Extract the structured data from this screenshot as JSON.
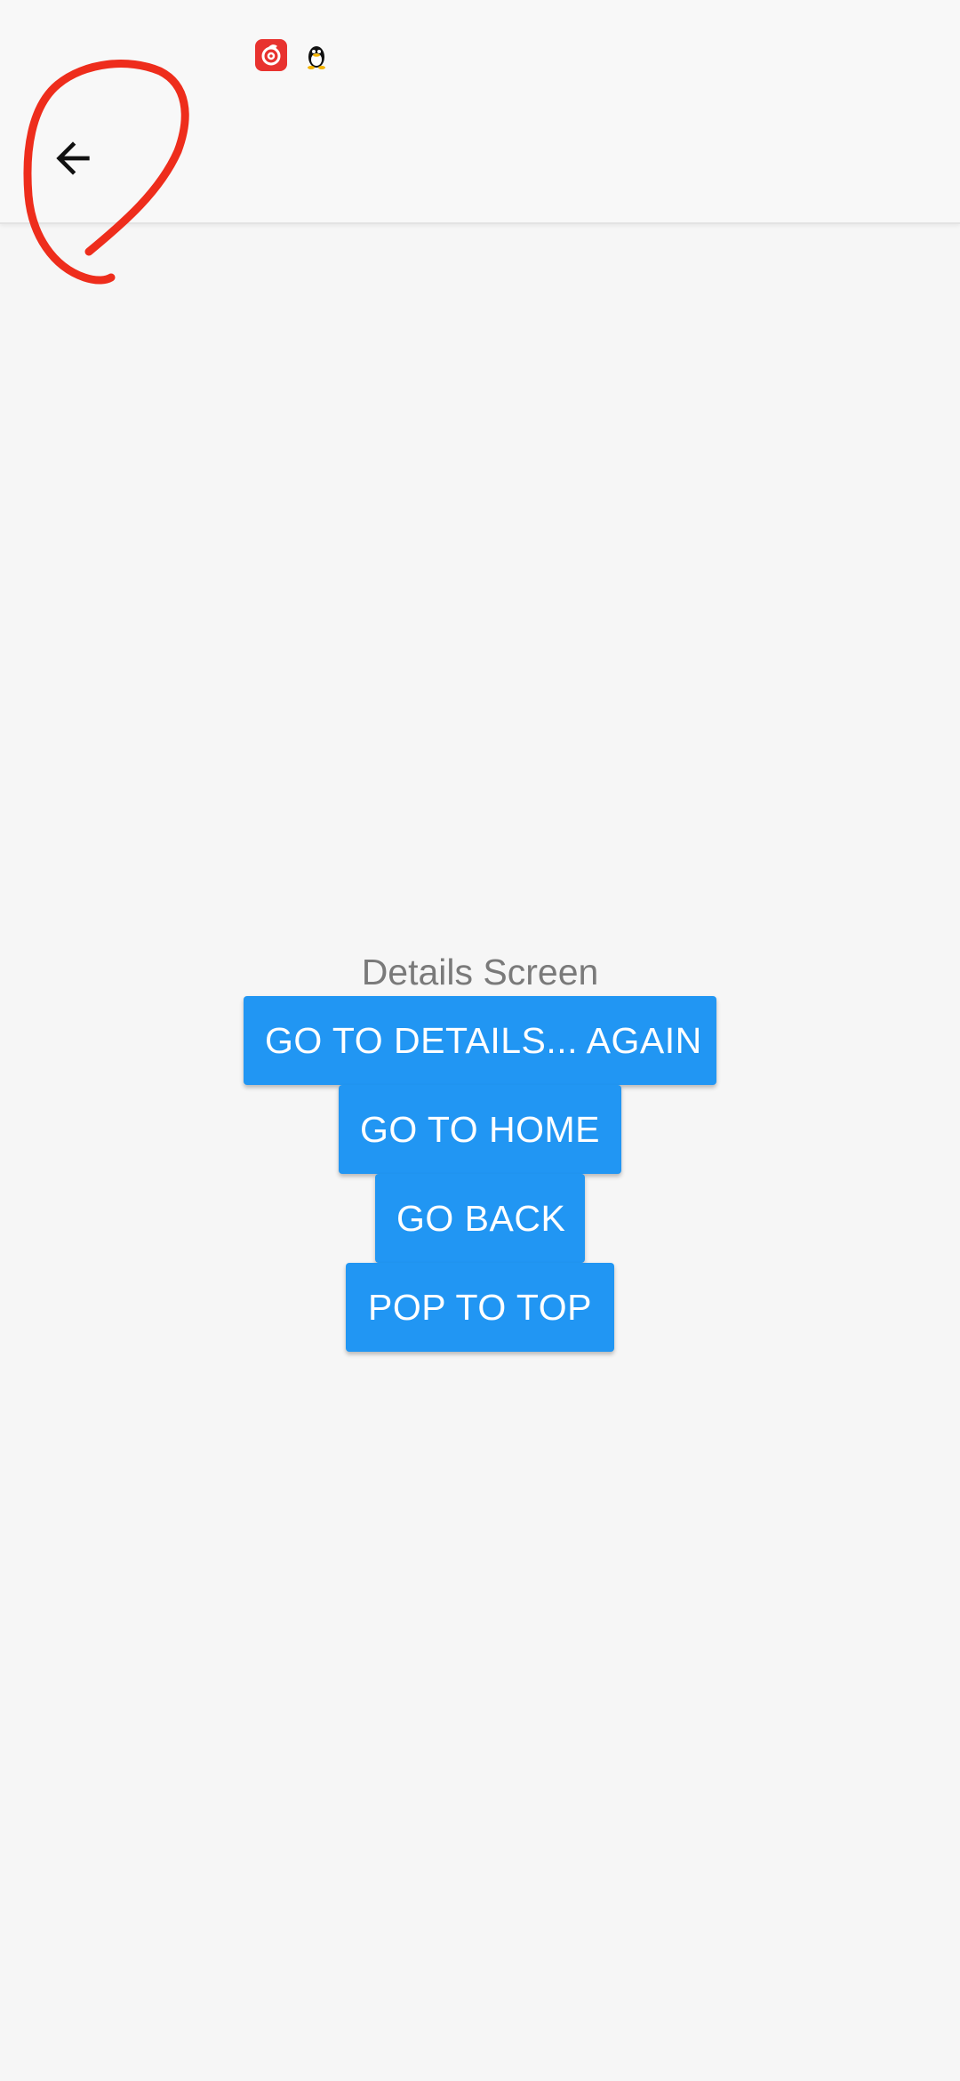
{
  "status_bar": {
    "icons": [
      "netease-music-icon",
      "qq-penguin-icon"
    ]
  },
  "header": {
    "back_icon": "arrow-left-icon"
  },
  "main": {
    "title": "Details Screen",
    "buttons": [
      {
        "label": "GO TO DETAILS... AGAIN"
      },
      {
        "label": "GO TO HOME"
      },
      {
        "label": "GO BACK"
      },
      {
        "label": "POP TO TOP"
      }
    ]
  },
  "colors": {
    "background": "#f6f6f6",
    "button": "#2196f3",
    "button_text": "#ffffff",
    "title_text": "#7a7a7a",
    "annotation": "#ee2d1c"
  }
}
